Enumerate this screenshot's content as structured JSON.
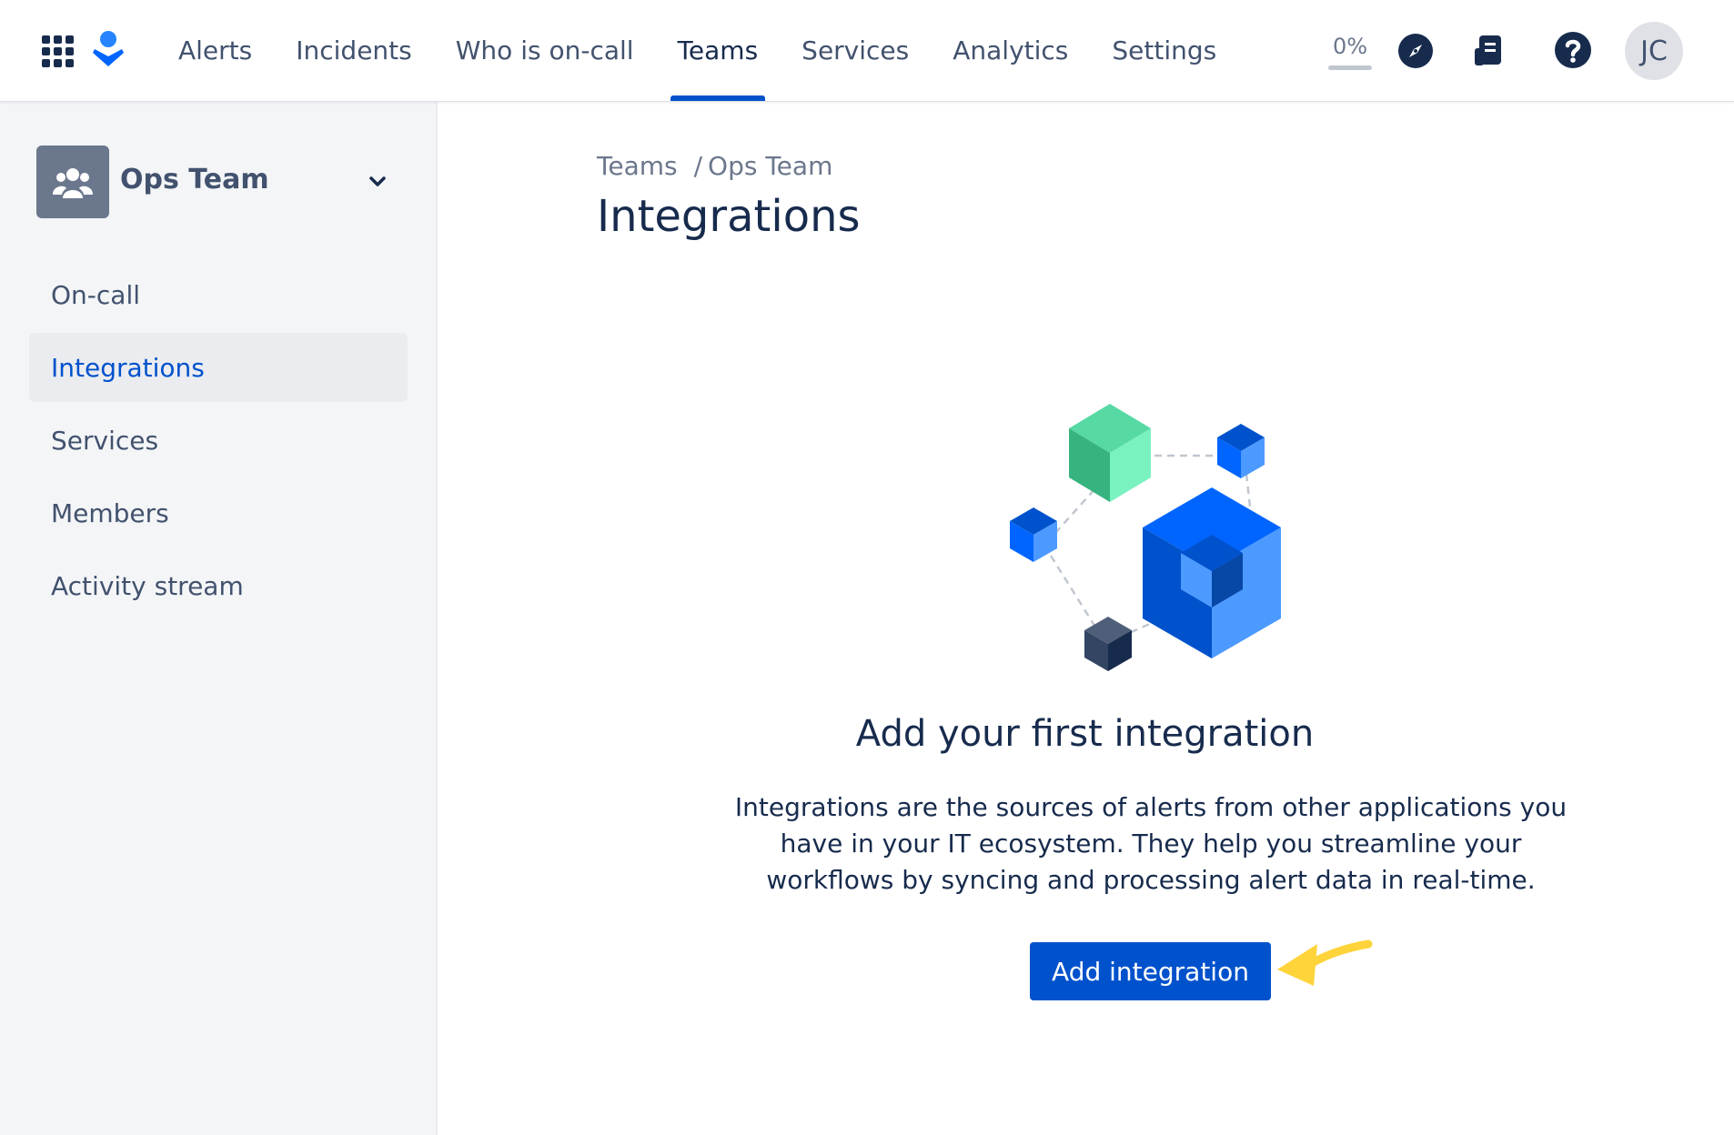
{
  "topnav": {
    "items": [
      {
        "label": "Alerts",
        "active": false
      },
      {
        "label": "Incidents",
        "active": false
      },
      {
        "label": "Who is on-call",
        "active": false
      },
      {
        "label": "Teams",
        "active": true
      },
      {
        "label": "Services",
        "active": false
      },
      {
        "label": "Analytics",
        "active": false
      },
      {
        "label": "Settings",
        "active": false
      }
    ],
    "progress": {
      "label": "0%",
      "value": 0
    },
    "icons": [
      "app-switcher-icon",
      "compass-icon",
      "release-notes-icon",
      "help-icon"
    ],
    "avatar_initials": "JC"
  },
  "sidebar": {
    "team_name": "Ops Team",
    "items": [
      {
        "label": "On-call",
        "active": false
      },
      {
        "label": "Integrations",
        "active": true
      },
      {
        "label": "Services",
        "active": false
      },
      {
        "label": "Members",
        "active": false
      },
      {
        "label": "Activity stream",
        "active": false
      }
    ]
  },
  "main": {
    "breadcrumb": [
      "Teams",
      "Ops Team"
    ],
    "title": "Integrations",
    "empty_state": {
      "title": "Add your first integration",
      "description": "Integrations are the sources of alerts from other applications you have in your IT ecosystem. They help you streamline your workflows by syncing and processing alert data in real-time.",
      "button_label": "Add integration"
    }
  },
  "colors": {
    "primary": "#0052CC",
    "text": "#172B4D",
    "subtle_text": "#42526E",
    "sidebar_bg": "#F4F5F7",
    "highlight_arrow": "#FFD43B",
    "cube_green": "#57D9A3",
    "cube_blue": "#0065FF",
    "cube_dark": "#253858"
  }
}
